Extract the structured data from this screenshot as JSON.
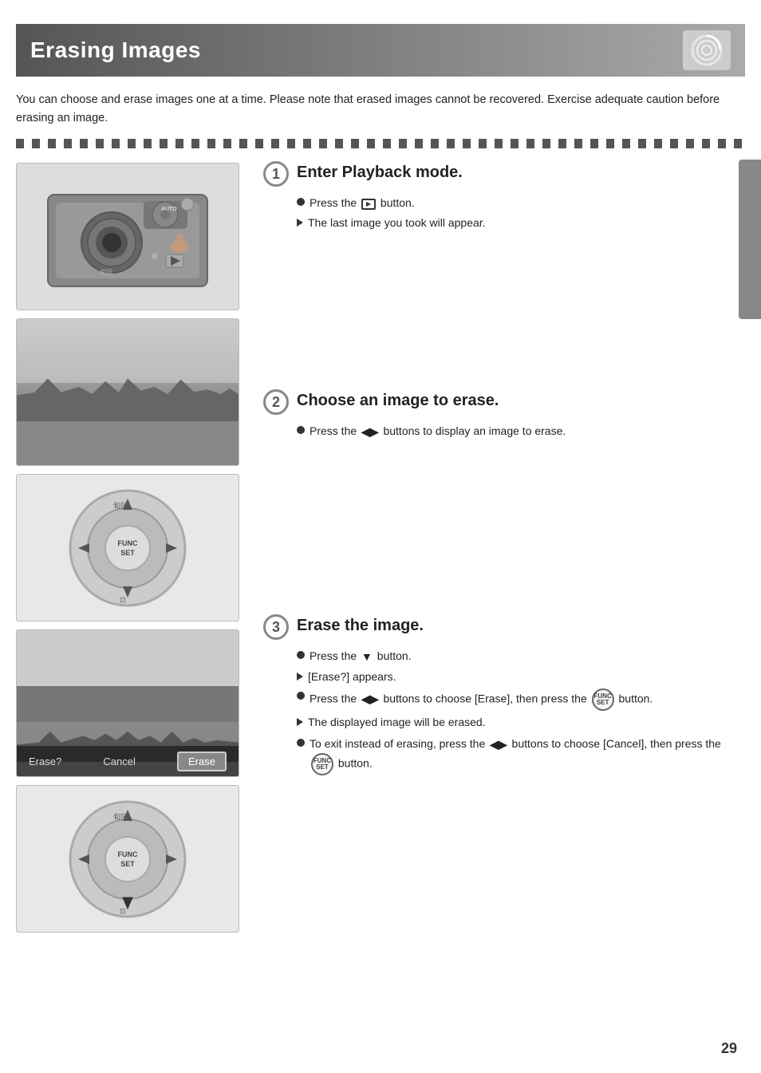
{
  "page": {
    "title": "Erasing Images",
    "title_icon_desc": "camera-spiral-icon",
    "intro": "You can choose and erase images one at a time. Please note that erased images cannot be recovered. Exercise adequate caution before erasing an image.",
    "page_number": "29"
  },
  "steps": [
    {
      "number": "1",
      "title": "Enter Playback mode.",
      "bullets": [
        {
          "type": "circle",
          "text": "Press the  button."
        },
        {
          "type": "arrow",
          "text": "The last image you took will appear."
        }
      ]
    },
    {
      "number": "2",
      "title": "Choose an image to erase.",
      "bullets": [
        {
          "type": "circle",
          "text": "Press the  buttons to display an image to erase."
        }
      ]
    },
    {
      "number": "3",
      "title": "Erase the image.",
      "bullets": [
        {
          "type": "circle",
          "text": "Press the  button."
        },
        {
          "type": "arrow",
          "text": "[Erase?] appears."
        },
        {
          "type": "circle",
          "text": "Press the  buttons to choose [Erase], then press the  button."
        },
        {
          "type": "arrow",
          "text": "The displayed image will be erased."
        },
        {
          "type": "circle",
          "text": "To exit instead of erasing, press the  buttons to choose [Cancel], then press the  button."
        }
      ]
    }
  ],
  "dialog": {
    "erase_label": "Erase?",
    "cancel_label": "Cancel",
    "erase_button": "Erase"
  }
}
